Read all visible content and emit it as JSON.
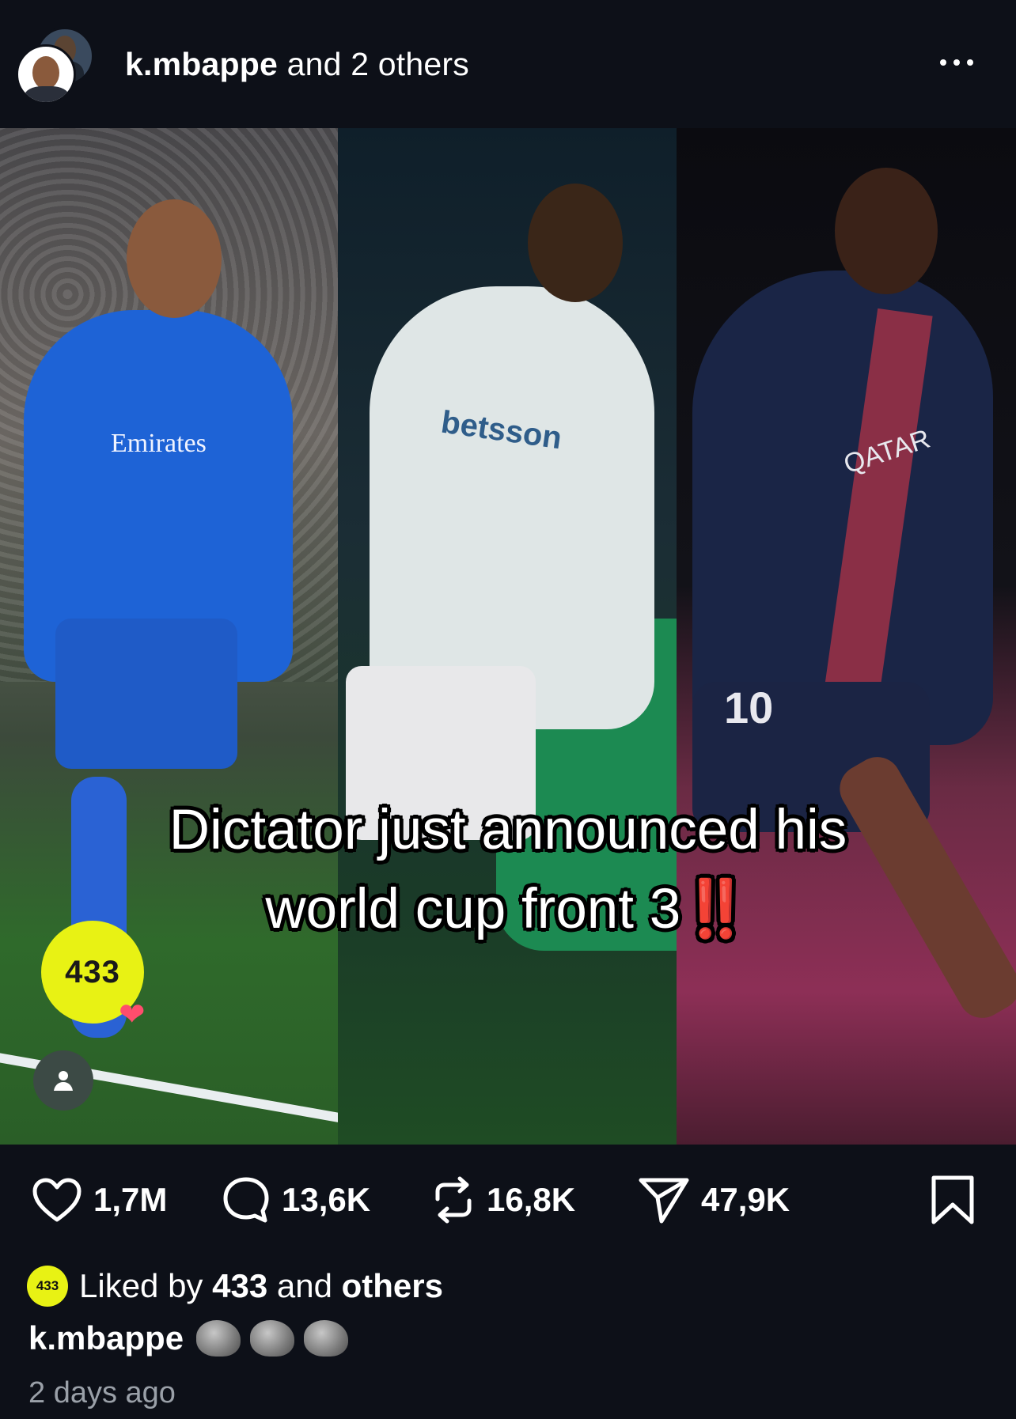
{
  "header": {
    "username": "k.mbappe",
    "others_text": "and 2 others",
    "more_icon": "more-horizontal-icon"
  },
  "media": {
    "overlay_line1": "Dictator just announced his",
    "overlay_line2": "world cup front 3",
    "overlay_emphasis": "‼️",
    "panel1_sponsor": "Emirates",
    "panel2_sponsor": "betsson",
    "panel3_sponsor": "QATAR",
    "panel3_number": "10",
    "badge_text": "433"
  },
  "actions": {
    "likes": "1,7M",
    "comments": "13,6K",
    "reposts": "16,8K",
    "shares": "47,9K"
  },
  "likes_row": {
    "prefix": "Liked by",
    "account": "433",
    "middle": "and",
    "suffix": "others",
    "avatar_text": "433"
  },
  "caption": {
    "username": "k.mbappe"
  },
  "timestamp": "2 days ago",
  "colors": {
    "background": "#0d1018",
    "badge": "#e8f214",
    "emphasis": "#e53232"
  }
}
